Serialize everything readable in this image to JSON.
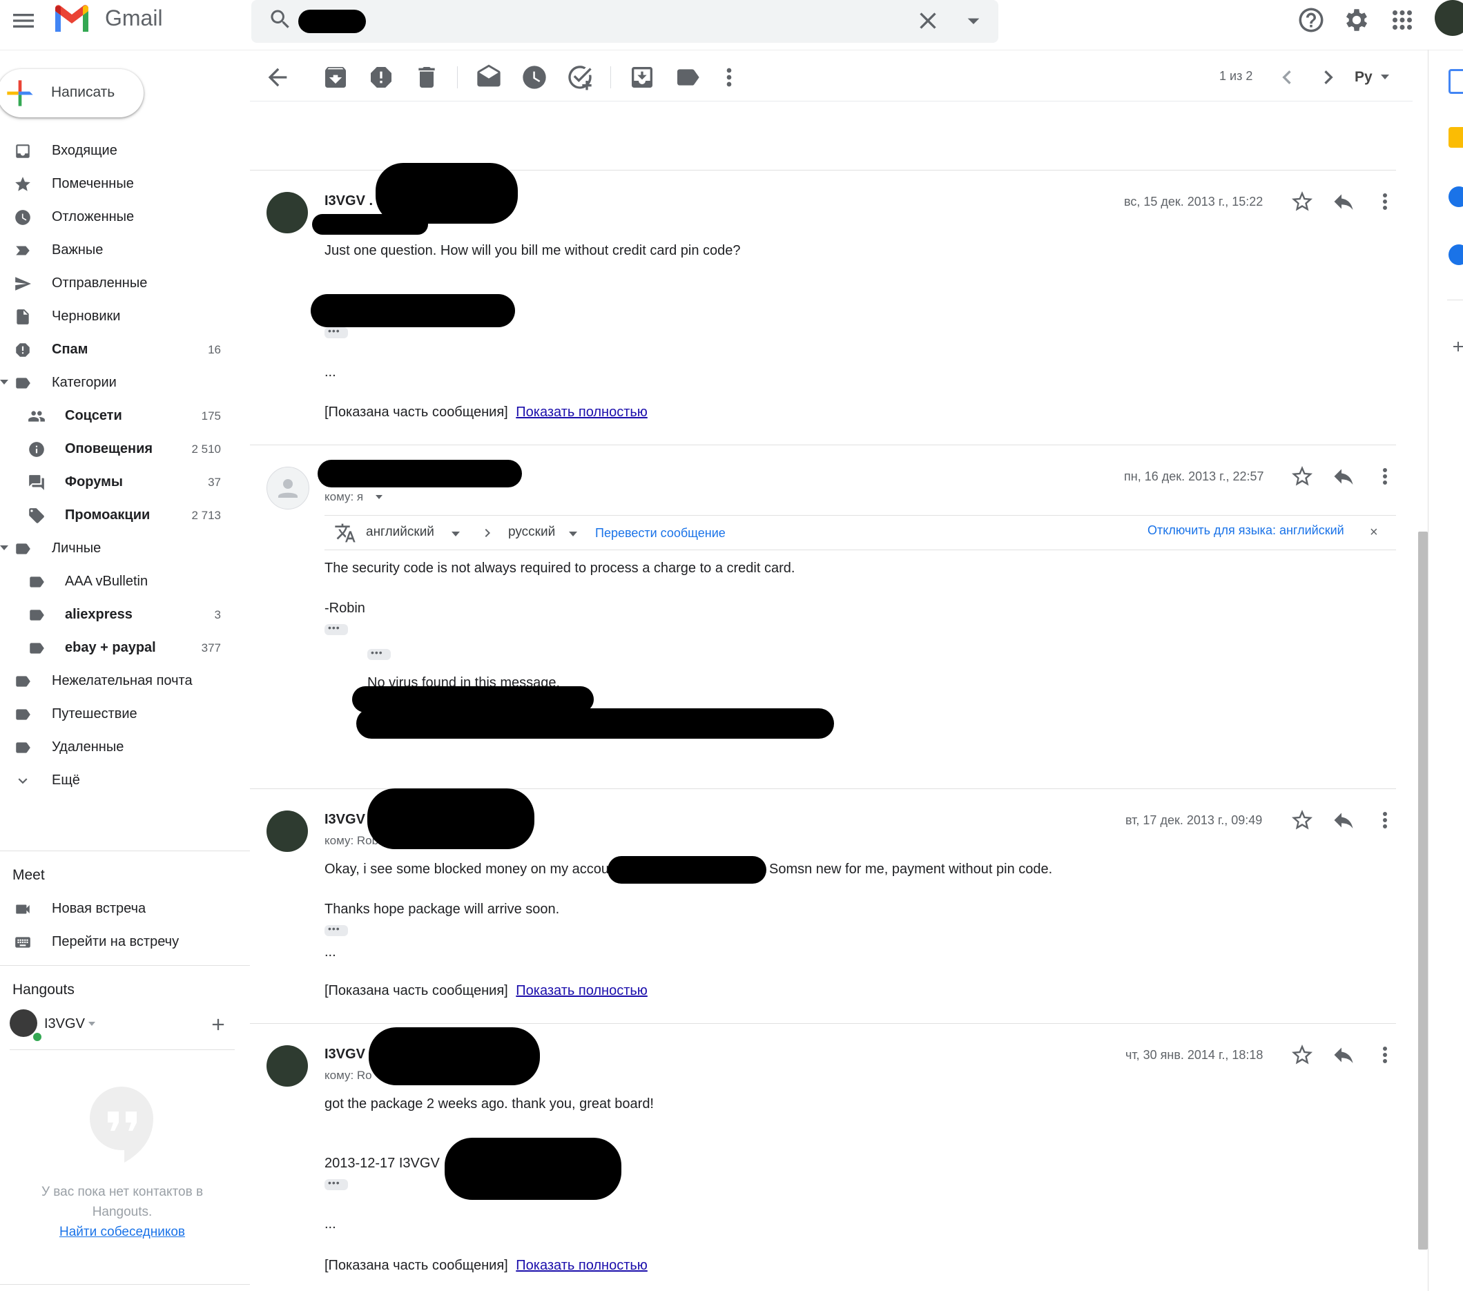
{
  "app": {
    "name": "Gmail"
  },
  "compose": {
    "label": "Написать"
  },
  "nav": {
    "items": [
      {
        "label": "Входящие",
        "count": ""
      },
      {
        "label": "Помеченные",
        "count": ""
      },
      {
        "label": "Отложенные",
        "count": ""
      },
      {
        "label": "Важные",
        "count": ""
      },
      {
        "label": "Отправленные",
        "count": ""
      },
      {
        "label": "Черновики",
        "count": ""
      },
      {
        "label": "Спам",
        "count": "16"
      },
      {
        "label": "Категории",
        "count": ""
      },
      {
        "label": "Соцсети",
        "count": "175"
      },
      {
        "label": "Оповещения",
        "count": "2 510"
      },
      {
        "label": "Форумы",
        "count": "37"
      },
      {
        "label": "Промоакции",
        "count": "2 713"
      },
      {
        "label": "Личные",
        "count": ""
      },
      {
        "label": "AAA vBulletin",
        "count": ""
      },
      {
        "label": "aliexpress",
        "count": "3"
      },
      {
        "label": "ebay + paypal",
        "count": "377"
      },
      {
        "label": "Нежелательная почта",
        "count": ""
      },
      {
        "label": "Путешествие",
        "count": ""
      },
      {
        "label": "Удаленные",
        "count": ""
      },
      {
        "label": "Ещё",
        "count": ""
      }
    ]
  },
  "meet": {
    "title": "Meet",
    "new_meeting": "Новая встреча",
    "join_meeting": "Перейти на встречу"
  },
  "hangouts": {
    "title": "Hangouts",
    "user": "I3VGV",
    "empty_text_1": "У вас пока нет контактов в",
    "empty_text_2": "Hangouts.",
    "find_link": "Найти собеседников"
  },
  "toolbar": {
    "page_count": "1 из 2",
    "input_tool": "Ру"
  },
  "translate": {
    "from": "английский",
    "to": "русский",
    "action": "Перевести сообщение",
    "disable": "Отключить для языка: английский"
  },
  "messages": [
    {
      "sender": "I3VGV .",
      "date": "вс, 15 дек. 2013 г., 15:22",
      "line1": "Just one question. How will you bill me without credit card pin code?",
      "ellipsis": "...",
      "partial": "[Показана часть сообщения]",
      "show_full": "Показать полностью"
    },
    {
      "to": "кому: я",
      "date": "пн, 16 дек. 2013 г., 22:57",
      "line1": "The security code is not always required to process a charge to a credit card.",
      "line2": "-Robin",
      "line3": "No virus found in this message."
    },
    {
      "sender": "I3VGV",
      "to": "кому: Rob",
      "date": "вт, 17 дек. 2013 г., 09:49",
      "line1a": "Okay, i see some blocked money on my accoun",
      "line1b": "Somsn new for me, payment without pin code.",
      "line2": "Thanks hope package will arrive soon.",
      "ellipsis": "...",
      "partial": "[Показана часть сообщения]",
      "show_full": "Показать полностью"
    },
    {
      "sender": "I3VGV",
      "to": "кому: Ro",
      "date": "чт, 30 янв. 2014 г., 18:18",
      "line1": "got the package 2 weeks ago. thank you, great board!",
      "line2": "2013-12-17 I3VGV .",
      "ellipsis": "...",
      "partial": "[Показана часть сообщения]",
      "show_full": "Показать полностью"
    }
  ]
}
